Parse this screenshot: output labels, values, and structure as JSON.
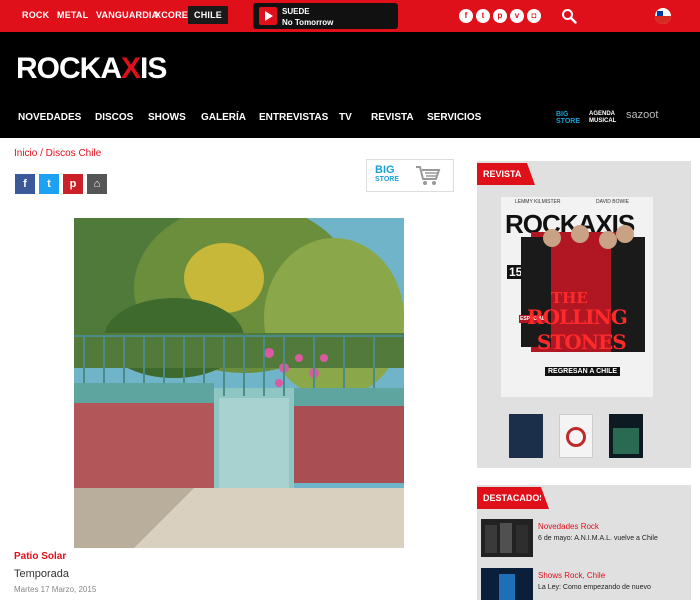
{
  "topbar": {
    "categories": [
      "ROCK",
      "METAL",
      "VANGUARDIA",
      "XCORE",
      "CHILE"
    ],
    "player": {
      "band": "SUEDE",
      "song": "No Tomorrow"
    },
    "social_icons": [
      "facebook-icon",
      "twitter-icon",
      "pinterest-icon",
      "vimeo-icon",
      "instagram-icon"
    ],
    "social_glyphs": [
      "f",
      "t",
      "p",
      "v",
      "◘"
    ]
  },
  "header": {
    "logo": {
      "part1": "ROCKA",
      "x": "X",
      "part2": "IS"
    },
    "nav": [
      "NOVEDADES",
      "DISCOS",
      "SHOWS",
      "GALERÍA",
      "ENTREVISTAS",
      "TV",
      "REVISTA",
      "SERVICIOS"
    ],
    "brands": [
      "BIG STORE",
      "AGENDA MUSICAL",
      "sazoot"
    ]
  },
  "content": {
    "breadcrumb": "Inicio / Discos Chile",
    "share": [
      "f",
      "t",
      "p",
      "⌂"
    ],
    "bigstore": {
      "line1": "BIG",
      "line2": "STORE"
    },
    "artist": "Patio Solar",
    "album": "Temporada",
    "date": "Martes 17 Marzo, 2015"
  },
  "sidebar": {
    "revista_title": "REVISTA",
    "magazine": {
      "top_left": "LEMMY KILMISTER",
      "top_right": "DAVID BOWIE",
      "logo": "ROCKAXIS",
      "issue": "153",
      "especial": "ESPECIAL",
      "headline1": "THE",
      "headline2": "ROLLING",
      "headline3": "STONES",
      "tagline": "REGRESAN A CHILE"
    },
    "destacados_title": "DESTACADOS",
    "destacados": [
      {
        "category": "Novedades Rock",
        "title": "6 de mayo: A.N.I.M.A.L. vuelve a Chile"
      },
      {
        "category": "Shows Rock, Chile",
        "title": "La Ley: Como empezando de nuevo"
      }
    ]
  },
  "colors": {
    "accent": "#e0101b",
    "header_bg": "#000000",
    "sidebar_bg": "#e0e0e0"
  }
}
